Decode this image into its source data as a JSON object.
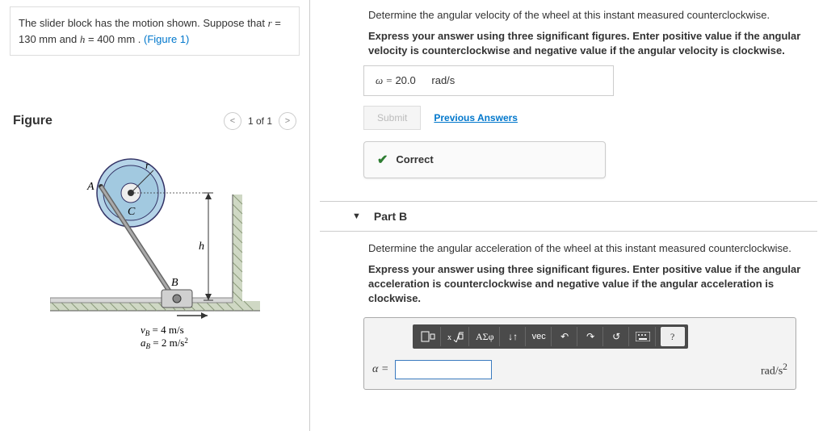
{
  "problem": {
    "text_prefix": "The slider block has the motion shown. Suppose that ",
    "r_var": "r",
    "r_eq": " = 130  mm",
    "and": " and ",
    "h_var": "h",
    "h_eq": " = 400  mm",
    "period": " . ",
    "figlink": "(Figure 1)"
  },
  "figure": {
    "title": "Figure",
    "pager": "1 of 1",
    "labels": {
      "A": "A",
      "C": "C",
      "r": "r",
      "h": "h",
      "B": "B",
      "vb": "v_B = 4 m/s",
      "ab": "a_B = 2 m/s²"
    }
  },
  "partA": {
    "prompt": "Determine the angular velocity of the wheel at this instant measured counterclockwise.",
    "instr": "Express your answer using three significant figures. Enter positive value if the angular velocity is counterclockwise and negative value if the angular velocity is clockwise.",
    "omega_label": "ω = ",
    "omega_value": "20.0",
    "unit": "rad/s",
    "submit": "Submit",
    "prev": "Previous Answers",
    "correct": "Correct"
  },
  "partB": {
    "title": "Part B",
    "prompt": "Determine the angular acceleration of the wheel at this instant measured counterclockwise.",
    "instr": "Express your answer using three significant figures. Enter positive value if the angular acceleration is counterclockwise and negative value if the angular acceleration is clockwise.",
    "toolbar": {
      "tmpl": "□",
      "frac": "x√",
      "greek": "ΑΣφ",
      "arrows": "↓↑",
      "vec": "vec",
      "undo": "↶",
      "redo": "↷",
      "reset": "↺",
      "keyboard": "⌨",
      "help": "?"
    },
    "alpha_label": "α = ",
    "unit": "rad/s²",
    "answer_value": ""
  }
}
